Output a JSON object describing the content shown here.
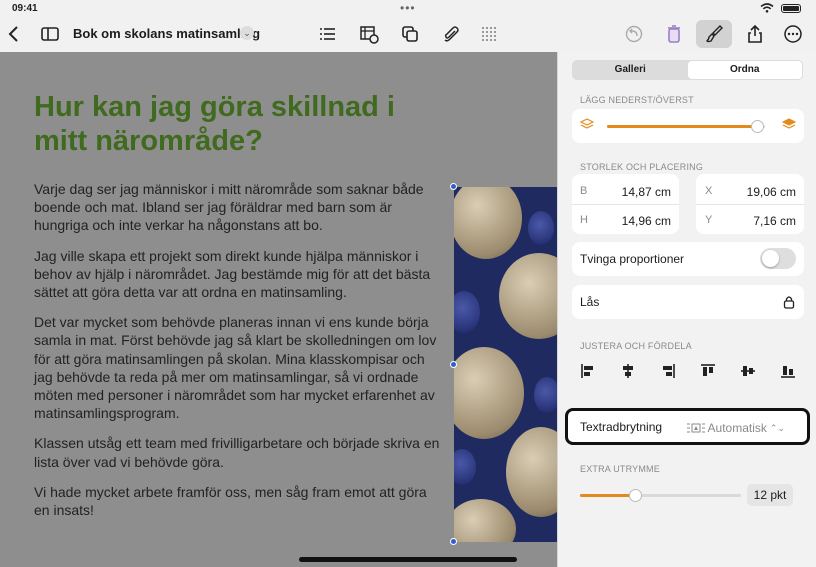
{
  "status": {
    "time": "09:41"
  },
  "toolbar": {
    "doc_title": "Bok om skolans matinsamling",
    "title_menu": "⌄",
    "icons": [
      "chevron-left-icon",
      "sidebar-icon",
      "list-icon",
      "table-chart-icon",
      "shapes-icon",
      "paperclip-icon",
      "texture-icon",
      "undo-icon",
      "trash-icon",
      "paintbrush-icon",
      "share-icon",
      "more-icon"
    ]
  },
  "document": {
    "heading": "Hur kan jag göra skillnad i mitt närområde?",
    "paragraphs": [
      "Varje dag ser jag människor i mitt närområde som saknar både boende och mat. Ibland ser jag föräldrar med barn som är hungriga och inte verkar ha någonstans att bo.",
      "Jag ville skapa ett projekt som direkt kunde hjälpa människor i behov av hjälp i närområdet. Jag bestämde mig för att det bästa sättet att göra detta var att ordna en matinsamling.",
      "Det var mycket som behövde planeras innan vi ens kunde börja samla in mat. Först behövde jag så klart be skolledningen om lov för att göra matinsamlingen på skolan. Mina klasskompisar och jag behövde ta reda på mer om matinsamlingar, så vi ordnade möten med personer i närområdet som har mycket erfarenhet av matinsamlingsprogram.",
      "Klassen utsåg ett team med frivilligarbetare och började skriva en lista över vad vi behövde göra.",
      "Vi hade mycket arbete framför oss, men såg fram emot att göra en insats!"
    ]
  },
  "inspector": {
    "tabs": [
      {
        "label": "Galleri",
        "active": false
      },
      {
        "label": "Ordna",
        "active": true
      }
    ],
    "layer_label": "LÄGG NEDERST/ÖVERST",
    "layer_value": 0.95,
    "size_label": "STORLEK OCH PLACERING",
    "fields": {
      "b": {
        "label": "B",
        "value": "14,87 cm"
      },
      "h": {
        "label": "H",
        "value": "14,96 cm"
      },
      "x": {
        "label": "X",
        "value": "19,06 cm"
      },
      "y": {
        "label": "Y",
        "value": "7,16 cm"
      }
    },
    "proportions_label": "Tvinga proportioner",
    "proportions_on": false,
    "lock_label": "Lås",
    "align_label": "JUSTERA OCH FÖRDELA",
    "wrap_label": "Textradbrytning",
    "wrap_value": "Automatisk",
    "wrap_chevron": "⌃⌄",
    "extra_label": "EXTRA UTRYMME",
    "extra_value": "12 pkt",
    "extra_fraction": 0.34
  },
  "colors": {
    "heading": "#406a1e",
    "accent": "#e28a1a",
    "selection": "#2f5fd0"
  }
}
